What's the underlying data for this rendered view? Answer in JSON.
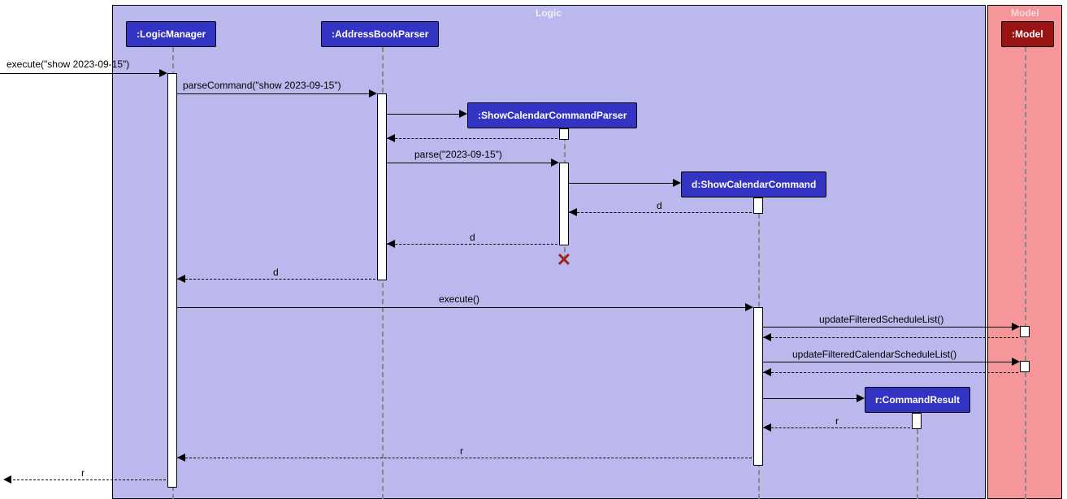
{
  "boxes": {
    "logic": {
      "label": "Logic"
    },
    "model": {
      "label": "Model"
    }
  },
  "participants": {
    "logicManager": ":LogicManager",
    "addressBookParser": ":AddressBookParser",
    "showCalendarCommandParser": ":ShowCalendarCommandParser",
    "showCalendarCommand": "d:ShowCalendarCommand",
    "commandResult": "r:CommandResult",
    "model": ":Model"
  },
  "messages": {
    "m1": "execute(\"show 2023-09-15\")",
    "m2": "parseCommand(\"show 2023-09-15\")",
    "r2": "",
    "m3": "parse(\"2023-09-15\")",
    "r3d": "d",
    "r3d2": "d",
    "r3d3": "d",
    "m4": "execute()",
    "m5": "updateFilteredScheduleList()",
    "m6": "updateFilteredCalendarScheduleList()",
    "r7": "r",
    "r8": "r",
    "r9": "r"
  },
  "chart_data": {
    "type": "sequence-diagram",
    "boxes": [
      {
        "name": "Logic",
        "participants": [
          "LogicManager",
          "AddressBookParser",
          "ShowCalendarCommandParser",
          "d:ShowCalendarCommand",
          "r:CommandResult"
        ]
      },
      {
        "name": "Model",
        "participants": [
          "Model"
        ]
      }
    ],
    "participants": [
      ":LogicManager",
      ":AddressBookParser",
      ":ShowCalendarCommandParser",
      "d:ShowCalendarCommand",
      "r:CommandResult",
      ":Model"
    ],
    "messages": [
      {
        "from": "external",
        "to": "LogicManager",
        "label": "execute(\"show 2023-09-15\")",
        "type": "sync"
      },
      {
        "from": "LogicManager",
        "to": "AddressBookParser",
        "label": "parseCommand(\"show 2023-09-15\")",
        "type": "sync"
      },
      {
        "from": "AddressBookParser",
        "to": "ShowCalendarCommandParser",
        "label": "",
        "type": "create"
      },
      {
        "from": "ShowCalendarCommandParser",
        "to": "AddressBookParser",
        "label": "",
        "type": "return"
      },
      {
        "from": "AddressBookParser",
        "to": "ShowCalendarCommandParser",
        "label": "parse(\"2023-09-15\")",
        "type": "sync"
      },
      {
        "from": "ShowCalendarCommandParser",
        "to": "ShowCalendarCommand",
        "label": "",
        "type": "create"
      },
      {
        "from": "ShowCalendarCommand",
        "to": "ShowCalendarCommandParser",
        "label": "d",
        "type": "return"
      },
      {
        "from": "ShowCalendarCommandParser",
        "to": "AddressBookParser",
        "label": "d",
        "type": "return"
      },
      {
        "from": "ShowCalendarCommandParser",
        "to": "",
        "label": "",
        "type": "destroy"
      },
      {
        "from": "AddressBookParser",
        "to": "LogicManager",
        "label": "d",
        "type": "return"
      },
      {
        "from": "LogicManager",
        "to": "ShowCalendarCommand",
        "label": "execute()",
        "type": "sync"
      },
      {
        "from": "ShowCalendarCommand",
        "to": "Model",
        "label": "updateFilteredScheduleList()",
        "type": "sync"
      },
      {
        "from": "Model",
        "to": "ShowCalendarCommand",
        "label": "",
        "type": "return"
      },
      {
        "from": "ShowCalendarCommand",
        "to": "Model",
        "label": "updateFilteredCalendarScheduleList()",
        "type": "sync"
      },
      {
        "from": "Model",
        "to": "ShowCalendarCommand",
        "label": "",
        "type": "return"
      },
      {
        "from": "ShowCalendarCommand",
        "to": "CommandResult",
        "label": "",
        "type": "create"
      },
      {
        "from": "CommandResult",
        "to": "ShowCalendarCommand",
        "label": "r",
        "type": "return"
      },
      {
        "from": "ShowCalendarCommand",
        "to": "LogicManager",
        "label": "r",
        "type": "return"
      },
      {
        "from": "LogicManager",
        "to": "external",
        "label": "r",
        "type": "return"
      }
    ]
  }
}
